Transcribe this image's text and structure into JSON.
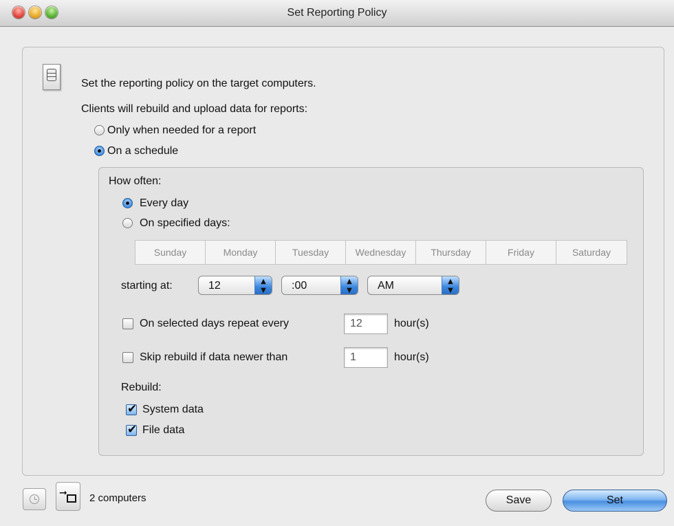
{
  "window": {
    "title": "Set Reporting Policy"
  },
  "intro": {
    "heading": "Set the reporting policy on the target computers.",
    "subheading": "Clients will rebuild and upload data for reports:"
  },
  "policy_options": [
    {
      "label": "Only when needed for a report",
      "selected": false
    },
    {
      "label": "On a schedule",
      "selected": true
    }
  ],
  "schedule": {
    "how_often_label": "How often:",
    "frequency_options": [
      {
        "label": "Every day",
        "selected": true
      },
      {
        "label": "On specified days:",
        "selected": false
      }
    ],
    "days": [
      "Sunday",
      "Monday",
      "Tuesday",
      "Wednesday",
      "Thursday",
      "Friday",
      "Saturday"
    ],
    "starting_at_label": "starting at:",
    "hour": "12",
    "minute": ":00",
    "ampm": "AM",
    "repeat": {
      "label": "On selected days repeat every",
      "checked": false,
      "value": "12",
      "unit": "hour(s)"
    },
    "skip": {
      "label": "Skip rebuild if data newer than",
      "checked": false,
      "value": "1",
      "unit": "hour(s)"
    },
    "rebuild_label": "Rebuild:",
    "rebuild_options": [
      {
        "label": "System data",
        "checked": true
      },
      {
        "label": "File data",
        "checked": true
      }
    ]
  },
  "footer": {
    "computers_count": "2 computers",
    "save_label": "Save",
    "set_label": "Set"
  }
}
